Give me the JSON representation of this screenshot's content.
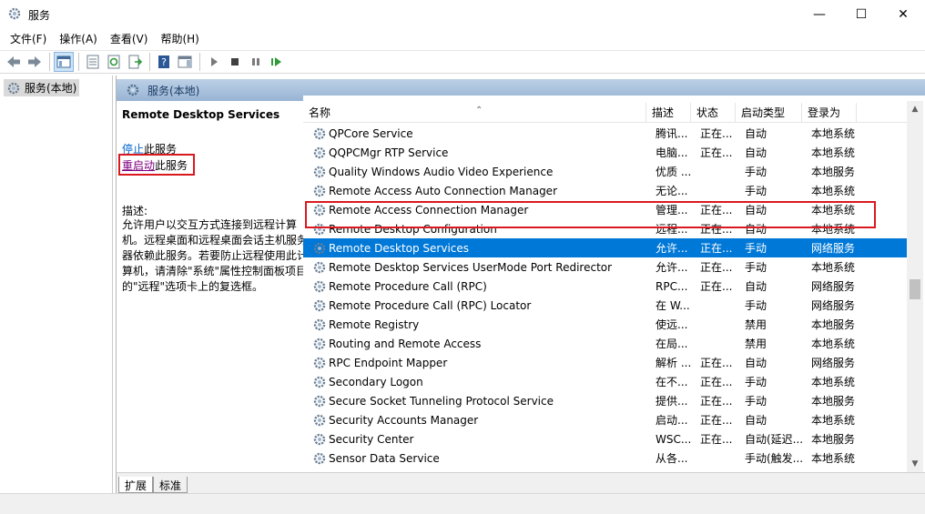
{
  "window": {
    "title": "服务",
    "minimize": "—",
    "maximize": "☐",
    "close": "✕"
  },
  "menu": [
    "文件(F)",
    "操作(A)",
    "查看(V)",
    "帮助(H)"
  ],
  "tree": {
    "label": "服务(本地)"
  },
  "content_header": "服务(本地)",
  "details": {
    "service_title": "Remote Desktop Services",
    "stop_link": "停止",
    "stop_suffix": "此服务",
    "restart_link": "重启动",
    "restart_suffix": "此服务",
    "desc_label": "描述:",
    "desc_text": "允许用户以交互方式连接到远程计算机。远程桌面和远程桌面会话主机服务器依赖此服务。若要防止远程使用此计算机，请清除\"系统\"属性控制面板项目的\"远程\"选项卡上的复选框。"
  },
  "columns": [
    "名称",
    "描述",
    "状态",
    "启动类型",
    "登录为"
  ],
  "sort_indicator": "⌃",
  "services": [
    {
      "name": "QPCore Service",
      "desc": "腾讯...",
      "status": "正在...",
      "startup": "自动",
      "logon": "本地系统"
    },
    {
      "name": "QQPCMgr RTP Service",
      "desc": "电脑...",
      "status": "正在...",
      "startup": "自动",
      "logon": "本地系统"
    },
    {
      "name": "Quality Windows Audio Video Experience",
      "desc": "优质 ...",
      "status": "",
      "startup": "手动",
      "logon": "本地服务"
    },
    {
      "name": "Remote Access Auto Connection Manager",
      "desc": "无论...",
      "status": "",
      "startup": "手动",
      "logon": "本地系统"
    },
    {
      "name": "Remote Access Connection Manager",
      "desc": "管理...",
      "status": "正在...",
      "startup": "自动",
      "logon": "本地系统"
    },
    {
      "name": "Remote Desktop Configuration",
      "desc": "远程...",
      "status": "正在...",
      "startup": "自动",
      "logon": "本地系统"
    },
    {
      "name": "Remote Desktop Services",
      "desc": "允许...",
      "status": "正在...",
      "startup": "手动",
      "logon": "网络服务"
    },
    {
      "name": "Remote Desktop Services UserMode Port Redirector",
      "desc": "允许...",
      "status": "正在...",
      "startup": "手动",
      "logon": "本地系统"
    },
    {
      "name": "Remote Procedure Call (RPC)",
      "desc": "RPC...",
      "status": "正在...",
      "startup": "自动",
      "logon": "网络服务"
    },
    {
      "name": "Remote Procedure Call (RPC) Locator",
      "desc": "在 W...",
      "status": "",
      "startup": "手动",
      "logon": "网络服务"
    },
    {
      "name": "Remote Registry",
      "desc": "使远...",
      "status": "",
      "startup": "禁用",
      "logon": "本地服务"
    },
    {
      "name": "Routing and Remote Access",
      "desc": "在局...",
      "status": "",
      "startup": "禁用",
      "logon": "本地系统"
    },
    {
      "name": "RPC Endpoint Mapper",
      "desc": "解析 ...",
      "status": "正在...",
      "startup": "自动",
      "logon": "网络服务"
    },
    {
      "name": "Secondary Logon",
      "desc": "在不...",
      "status": "正在...",
      "startup": "手动",
      "logon": "本地系统"
    },
    {
      "name": "Secure Socket Tunneling Protocol Service",
      "desc": "提供...",
      "status": "正在...",
      "startup": "手动",
      "logon": "本地服务"
    },
    {
      "name": "Security Accounts Manager",
      "desc": "启动...",
      "status": "正在...",
      "startup": "自动",
      "logon": "本地系统"
    },
    {
      "name": "Security Center",
      "desc": "WSC...",
      "status": "正在...",
      "startup": "自动(延迟...",
      "logon": "本地服务"
    },
    {
      "name": "Sensor Data Service",
      "desc": "从各...",
      "status": "",
      "startup": "手动(触发...",
      "logon": "本地系统"
    }
  ],
  "selected_index": 6,
  "tabs": [
    "扩展",
    "标准"
  ],
  "colors": {
    "selection": "#0078d7",
    "highlight_box": "#d9191f",
    "link": "#0066cc"
  }
}
